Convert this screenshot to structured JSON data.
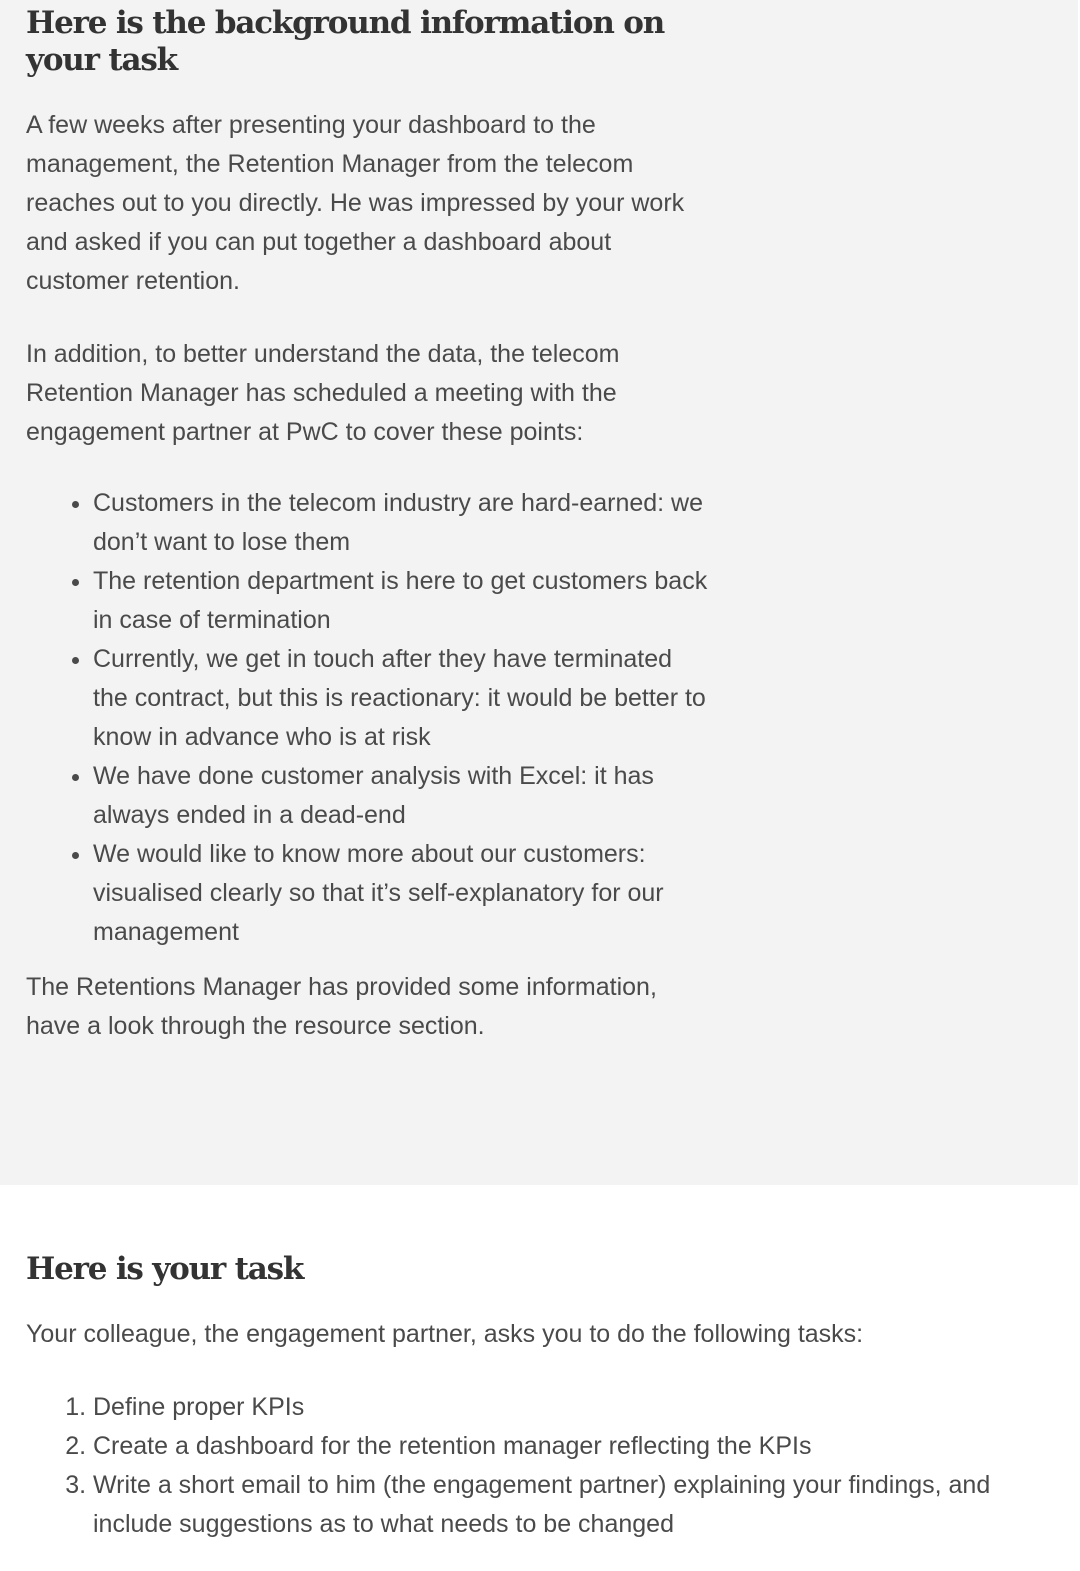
{
  "background": {
    "title": "Here is the background information on your task",
    "paragraph1": "A few weeks after presenting your dashboard to the management, the Retention Manager from the telecom reaches out to you directly. He was impressed by your work and asked if you can put together a dashboard about customer retention.",
    "paragraph2": "In addition, to better understand the data, the telecom Retention Manager has scheduled a meeting with the engagement partner at PwC to cover these points:",
    "bullets": [
      "Customers in the telecom industry are hard-earned: we don’t want to lose them",
      "The retention department is here to get customers back in case of termination",
      "Currently, we get in touch after they have terminated the contract, but this is reactionary: it would be better to know in advance who is at risk",
      "We  have done customer analysis with Excel: it has always ended in a dead-end",
      "We would like to know more about our customers: visualised clearly so that it’s self-explanatory for our management"
    ],
    "paragraph3": "The Retentions Manager has provided some information, have a look through the resource section."
  },
  "task": {
    "title": "Here is your task",
    "intro": "Your colleague, the engagement partner, asks you to do the following tasks:",
    "steps": [
      "Define proper KPIs",
      "Create a dashboard for the retention manager reflecting the KPIs",
      "Write a short email to him (the engagement partner) explaining your findings, and include suggestions as to what needs to be changed"
    ]
  }
}
